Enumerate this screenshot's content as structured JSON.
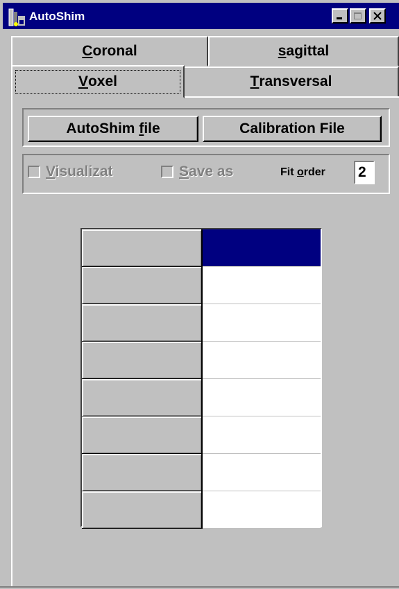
{
  "window": {
    "title": "AutoShim",
    "icons": {
      "app": "autoshim-app-icon",
      "minimize": "minimize-icon",
      "maximize": "maximize-icon",
      "close": "close-icon"
    }
  },
  "tabs": {
    "row1": [
      {
        "accel": "C",
        "rest": "oronal",
        "label": "Coronal"
      },
      {
        "accel": "s",
        "rest": "agittal",
        "label": "sagittal"
      }
    ],
    "row2": [
      {
        "accel": "V",
        "rest": "oxel",
        "label": "Voxel",
        "active": true
      },
      {
        "accel": "T",
        "rest": "ransversal",
        "label": "Transversal"
      }
    ]
  },
  "buttons": {
    "autoshim_file": {
      "pre": "AutoShim ",
      "accel": "f",
      "post": "ile"
    },
    "calibration_file": {
      "label": "Calibration File"
    }
  },
  "options": {
    "visualize": {
      "accel": "V",
      "rest": "isualizat",
      "checked": false,
      "enabled": false
    },
    "save_as": {
      "accel": "S",
      "rest": "ave as",
      "checked": false,
      "enabled": false
    },
    "fit_order": {
      "pre": "Fit ",
      "accel": "o",
      "post": "rder",
      "value": "2"
    }
  },
  "grid": {
    "rows": 8,
    "selected_row": 0,
    "header_cells": [
      "",
      "",
      "",
      "",
      "",
      "",
      "",
      ""
    ],
    "value_cells": [
      "",
      "",
      "",
      "",
      "",
      "",
      "",
      ""
    ]
  },
  "colors": {
    "titlebar": "#000080",
    "face": "#c0c0c0",
    "selection": "#000080"
  }
}
